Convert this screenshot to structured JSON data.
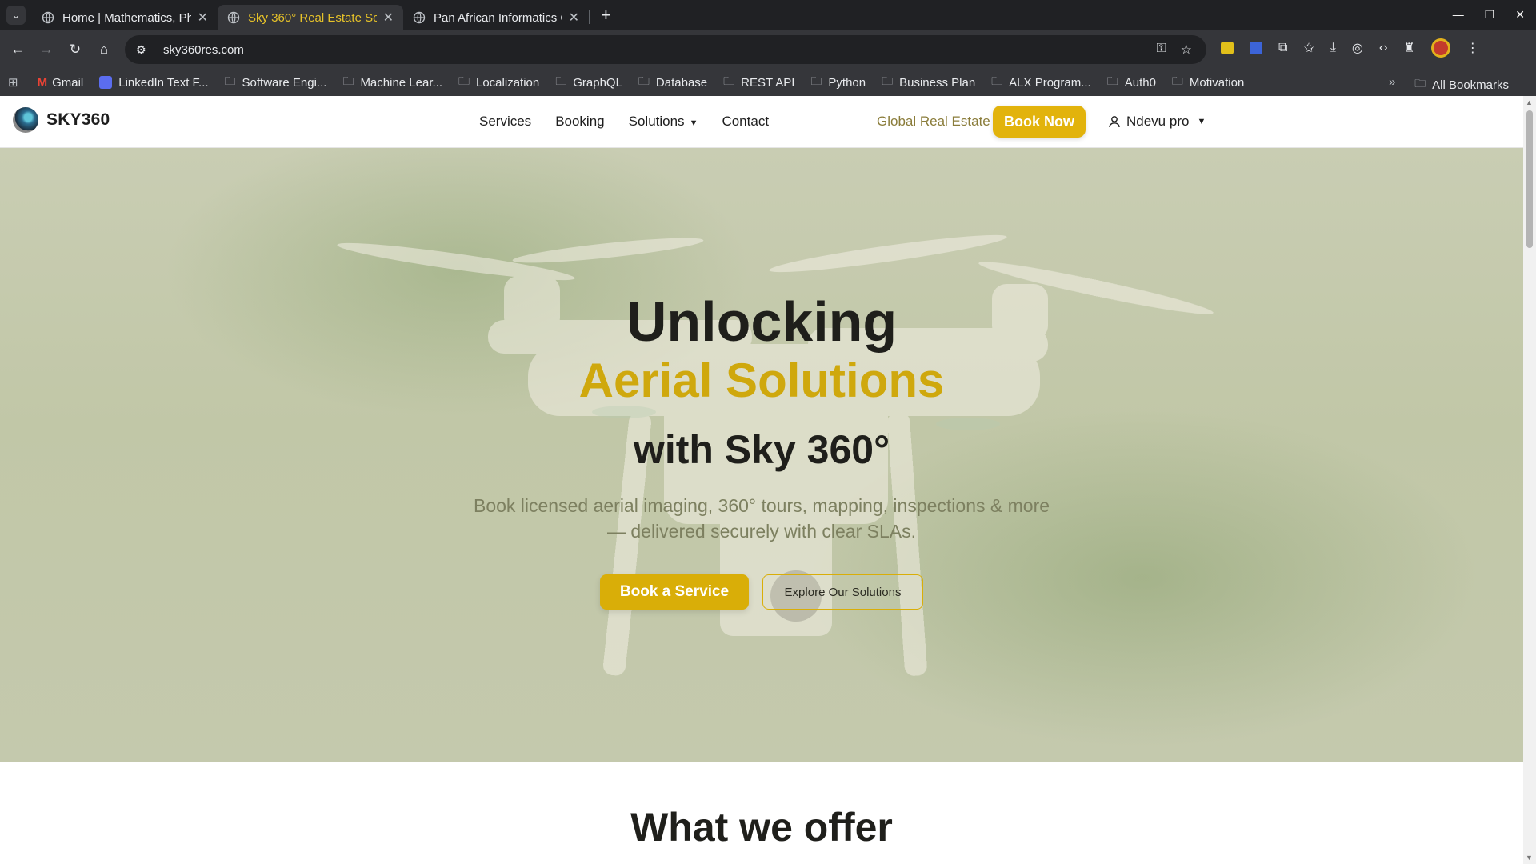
{
  "browser": {
    "tabs": [
      {
        "title": "Home | Mathematics, Ph",
        "active": false
      },
      {
        "title": "Sky 360° Real Estate Solu",
        "active": true
      },
      {
        "title": "Pan African Informatics C",
        "active": false
      }
    ],
    "url": "sky360res.com",
    "bookmarks": [
      {
        "label": "Gmail",
        "icon": "gmail-icon"
      },
      {
        "label": "LinkedIn Text F...",
        "icon": "linkedin-icon"
      },
      {
        "label": "Software Engi...",
        "icon": "folder-icon"
      },
      {
        "label": "Machine Lear...",
        "icon": "folder-icon"
      },
      {
        "label": "Localization",
        "icon": "folder-icon"
      },
      {
        "label": "GraphQL",
        "icon": "folder-icon"
      },
      {
        "label": "Database",
        "icon": "folder-icon"
      },
      {
        "label": "REST API",
        "icon": "folder-icon"
      },
      {
        "label": "Python",
        "icon": "folder-icon"
      },
      {
        "label": "Business Plan",
        "icon": "folder-icon"
      },
      {
        "label": "ALX Program...",
        "icon": "folder-icon"
      },
      {
        "label": "Auth0",
        "icon": "folder-icon"
      },
      {
        "label": "Motivation",
        "icon": "folder-icon"
      }
    ],
    "all_bookmarks_label": "All Bookmarks"
  },
  "site": {
    "brand": "SKY360",
    "nav": {
      "services": "Services",
      "booking": "Booking",
      "solutions": "Solutions",
      "contact": "Contact"
    },
    "global_link": "Global Real Estate",
    "book_now": "Book Now",
    "user_name": "Ndevu pro",
    "hero": {
      "line1": "Unlocking",
      "line2": "Aerial Solutions",
      "line3": "with Sky 360°",
      "sub1": "Book licensed aerial imaging, 360° tours, mapping, inspections & more",
      "sub2": "— delivered securely with clear SLAs.",
      "primary_button": "Book a Service",
      "secondary_button": "Explore Our Solutions"
    },
    "offer_heading": "What we offer"
  },
  "colors": {
    "accent": "#e2b30c",
    "accent_text": "#cfa80d",
    "browser_dark": "#202124",
    "browser_toolbar": "#35363a"
  }
}
